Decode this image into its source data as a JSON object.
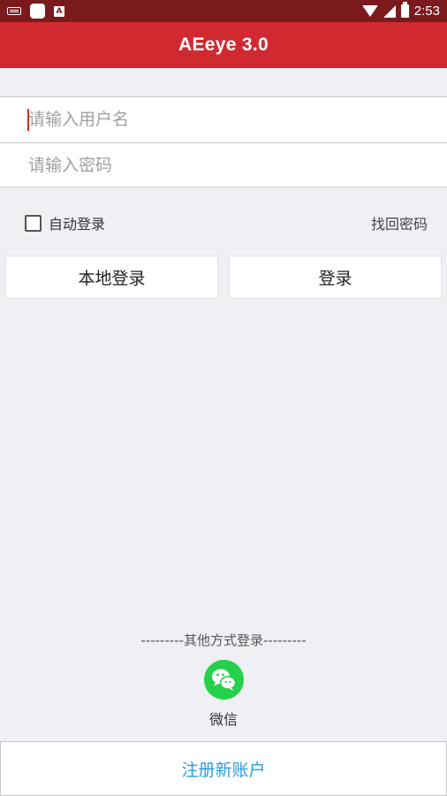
{
  "status_bar": {
    "time": "2:53",
    "left_icons": [
      "keyboard-icon",
      "app-square-icon",
      "text-a-icon"
    ],
    "right_icons": [
      "wifi-icon",
      "signal-icon",
      "battery-icon"
    ]
  },
  "app_bar": {
    "title": "AEeye 3.0"
  },
  "form": {
    "username_placeholder": "请输入用户名",
    "password_placeholder": "请输入密码"
  },
  "options": {
    "auto_login_label": "自动登录",
    "auto_login_checked": false,
    "forgot_password": "找回密码"
  },
  "buttons": {
    "local_login": "本地登录",
    "login": "登录"
  },
  "other_login": {
    "label": "---------其他方式登录---------",
    "wechat_label": "微信"
  },
  "register": {
    "label": "注册新账户"
  },
  "colors": {
    "status_bar": "#7a1a1d",
    "app_bar": "#d02a30",
    "background": "#eff0f4",
    "wechat": "#23d14c",
    "register_text": "#2a9be0"
  }
}
